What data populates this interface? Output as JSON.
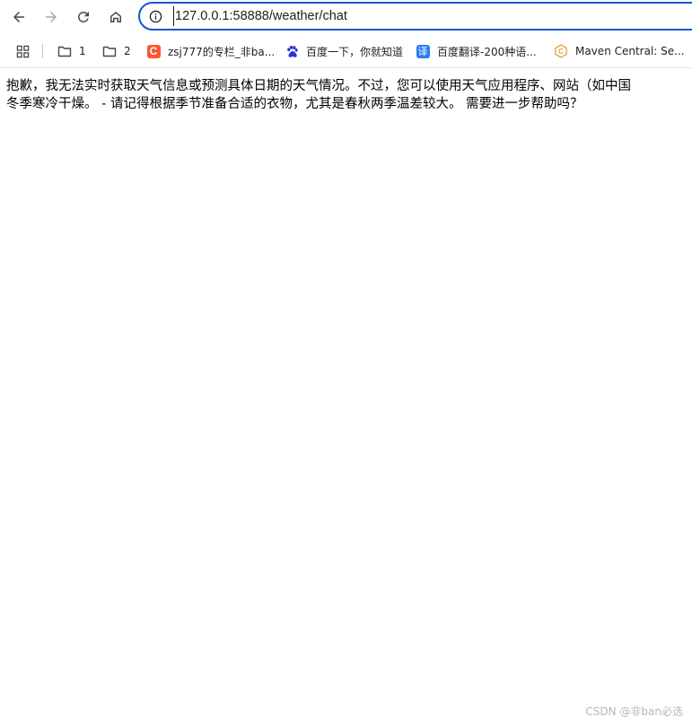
{
  "browser": {
    "url": "127.0.0.1:58888/weather/chat"
  },
  "bookmarks": [
    {
      "label": "1",
      "icon": "folder-icon"
    },
    {
      "label": "2",
      "icon": "folder-icon"
    },
    {
      "label": "zsj777的专栏_非ba...",
      "icon": "csdn-icon",
      "icon_text": "C",
      "color": "#fc5531"
    },
    {
      "label": "百度一下，你就知道",
      "icon": "baidu-paw-icon",
      "color": "#2932e1"
    },
    {
      "label": "百度翻译-200种语...",
      "icon": "baidu-translate-icon",
      "icon_text": "译",
      "color": "#2b7bf0"
    },
    {
      "label": "Maven Central: Se...",
      "icon": "maven-central-icon",
      "icon_text": "C",
      "color": "#e8a33b"
    }
  ],
  "page": {
    "line1": "抱歉，我无法实时获取天气信息或预测具体日期的天气情况。不过，您可以使用天气应用程序、网站（如中国",
    "line2": "冬季寒冷干燥。 - 请记得根据季节准备合适的衣物，尤其是春秋两季温差较大。 需要进一步帮助吗？"
  },
  "watermark": "CSDN @非ban必选",
  "colors": {
    "accent": "#0b57d0",
    "icon_gray": "#474747"
  }
}
